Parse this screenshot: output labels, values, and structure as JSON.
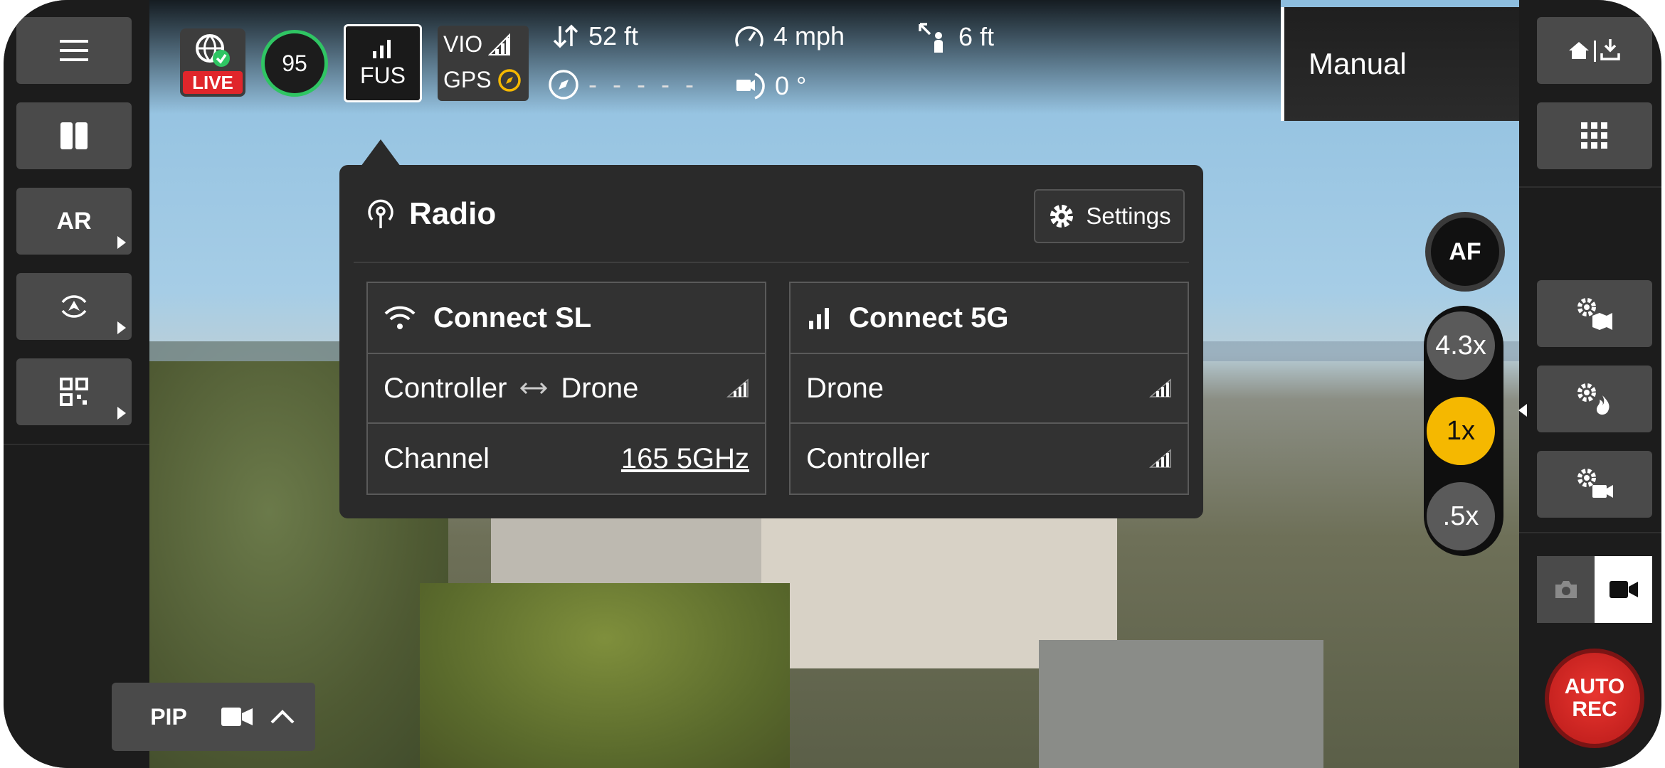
{
  "status": {
    "live_label": "LIVE",
    "health_score": "95",
    "fus_label": "FUS",
    "vio_label": "VIO",
    "gps_label": "GPS"
  },
  "telemetry": {
    "altitude": "52 ft",
    "speed": "4 mph",
    "distance": "6 ft",
    "heading": "- - - - -",
    "gimbal_angle": "0 °"
  },
  "mode": {
    "label": "Manual"
  },
  "left_sidebar": {
    "ar_label": "AR"
  },
  "radio_popup": {
    "title": "Radio",
    "settings_label": "Settings",
    "connect_sl": {
      "title": "Connect SL",
      "link_from": "Controller",
      "link_to": "Drone",
      "channel_label": "Channel",
      "channel_value": "165 5GHz"
    },
    "connect_5g": {
      "title": "Connect 5G",
      "drone_label": "Drone",
      "controller_label": "Controller"
    }
  },
  "camera": {
    "af_label": "AF",
    "zoom_options": [
      "4.3x",
      "1x",
      ".5x"
    ],
    "selected_zoom": "1x",
    "auto_rec_line1": "AUTO",
    "auto_rec_line2": "REC"
  },
  "bottom_bar": {
    "pip_label": "PIP"
  },
  "colors": {
    "accent_yellow": "#f5b800",
    "live_red": "#e0262b",
    "score_green": "#2fc563",
    "rec_red": "#e8352f"
  }
}
